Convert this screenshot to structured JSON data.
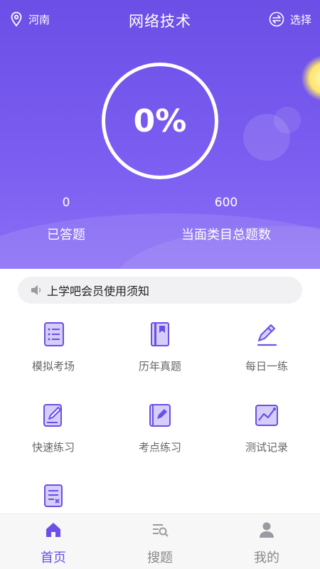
{
  "header": {
    "location": "河南",
    "title": "网络技术",
    "select_label": "选择"
  },
  "progress": {
    "percent_text": "0%",
    "answered_count": "0",
    "answered_label": "已答题",
    "total_count": "600",
    "total_label": "当面类目总题数"
  },
  "notice": {
    "text": "上学吧会员使用须知"
  },
  "features": [
    {
      "label": "模拟考场",
      "icon": "document-list-icon"
    },
    {
      "label": "历年真题",
      "icon": "book-icon"
    },
    {
      "label": "每日一练",
      "icon": "pencil-icon"
    },
    {
      "label": "快速练习",
      "icon": "edit-note-icon"
    },
    {
      "label": "考点练习",
      "icon": "notebook-pen-icon"
    },
    {
      "label": "测试记录",
      "icon": "chart-record-icon"
    },
    {
      "label": "",
      "icon": "exam-paper-icon"
    }
  ],
  "tabs": [
    {
      "label": "首页",
      "icon": "home-icon",
      "active": true
    },
    {
      "label": "搜题",
      "icon": "search-list-icon",
      "active": false
    },
    {
      "label": "我的",
      "icon": "person-icon",
      "active": false
    }
  ],
  "colors": {
    "accent": "#6b4fe6",
    "hero_light": "#8a6ef5",
    "icon_fill": "#c9bef7"
  }
}
